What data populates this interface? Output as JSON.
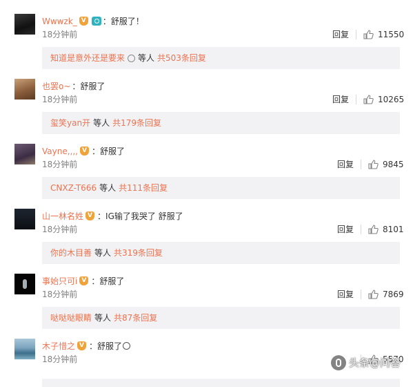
{
  "reply_label": "回复",
  "comments": [
    {
      "username": "Wwwzk_",
      "text": "舒服了！",
      "time": "18分钟前",
      "likes": "11550",
      "reply_preview": {
        "who": "知道是意外还是要来",
        "mid": "等人",
        "total": "共503条回复"
      }
    },
    {
      "username": "也罢o~",
      "text": "舒服了",
      "time": "18分钟前",
      "likes": "10265",
      "reply_preview": {
        "who": "玺笑yan开",
        "mid": "等人",
        "total": "共179条回复"
      }
    },
    {
      "username": "Vayne,,,,",
      "text": "舒服了",
      "time": "18分钟前",
      "likes": "9845",
      "reply_preview": {
        "who": "CNXZ-T666",
        "mid": "等人",
        "total": "共111条回复"
      }
    },
    {
      "username": "山一林名姓",
      "text": "IG输了我哭了 舒服了",
      "time": "18分钟前",
      "likes": "8101",
      "reply_preview": {
        "who": "你的木目善",
        "mid": "等人",
        "total": "共319条回复"
      }
    },
    {
      "username": "事始只可i",
      "text": "舒服了",
      "time": "18分钟前",
      "likes": "7869",
      "reply_preview": {
        "who": "哒哒哒眼睛",
        "mid": "等人",
        "total": "共87条回复"
      }
    },
    {
      "username": "木子惜之",
      "text": "舒服了",
      "time": "18分钟前",
      "likes": "5570"
    }
  ],
  "watermark": {
    "text": "头条@问答"
  }
}
